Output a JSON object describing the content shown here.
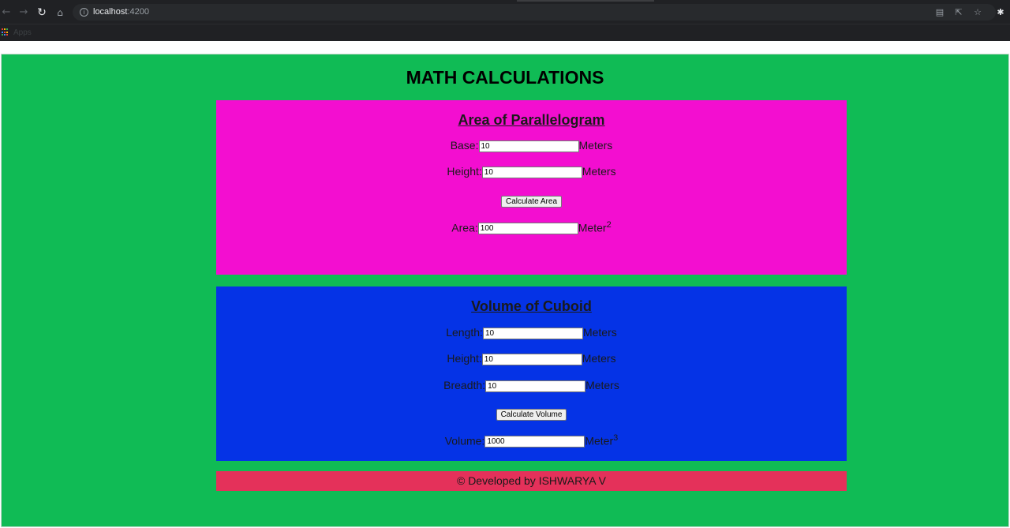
{
  "browser": {
    "url_host": "localhost",
    "url_port": ":4200",
    "bookmarks_apps_label": "Apps",
    "icons": [
      "back-icon",
      "forward-icon",
      "reload-icon",
      "home-icon",
      "info-icon",
      "translate-icon",
      "share-icon",
      "star-icon",
      "extensions-icon",
      "apps-grid-icon"
    ]
  },
  "page": {
    "title": "MATH CALCULATIONS",
    "background": "#10bb55"
  },
  "area": {
    "heading": "Area of Parallelogram",
    "base_label": "Base:",
    "base_value": "10",
    "base_unit": "Meters",
    "height_label": "Height:",
    "height_value": "10",
    "height_unit": "Meters",
    "button_label": "Calculate Area",
    "result_label": "Area:",
    "result_value": "100",
    "result_unit": "Meter",
    "result_exponent": "2",
    "color": "#f30ed0"
  },
  "volume": {
    "heading": "Volume of Cuboid",
    "length_label": "Length:",
    "length_value": "10",
    "length_unit": "Meters",
    "height_label": "Height:",
    "height_value": "10",
    "height_unit": "Meters",
    "breadth_label": "Breadth:",
    "breadth_value": "10",
    "breadth_unit": "Meters",
    "button_label": "Calculate Volume",
    "result_label": "Volume:",
    "result_value": "1000",
    "result_unit": "Meter",
    "result_exponent": "3",
    "color": "#0533e6"
  },
  "footer": {
    "text": "© Developed by ISHWARYA V",
    "color": "#e4315a"
  }
}
